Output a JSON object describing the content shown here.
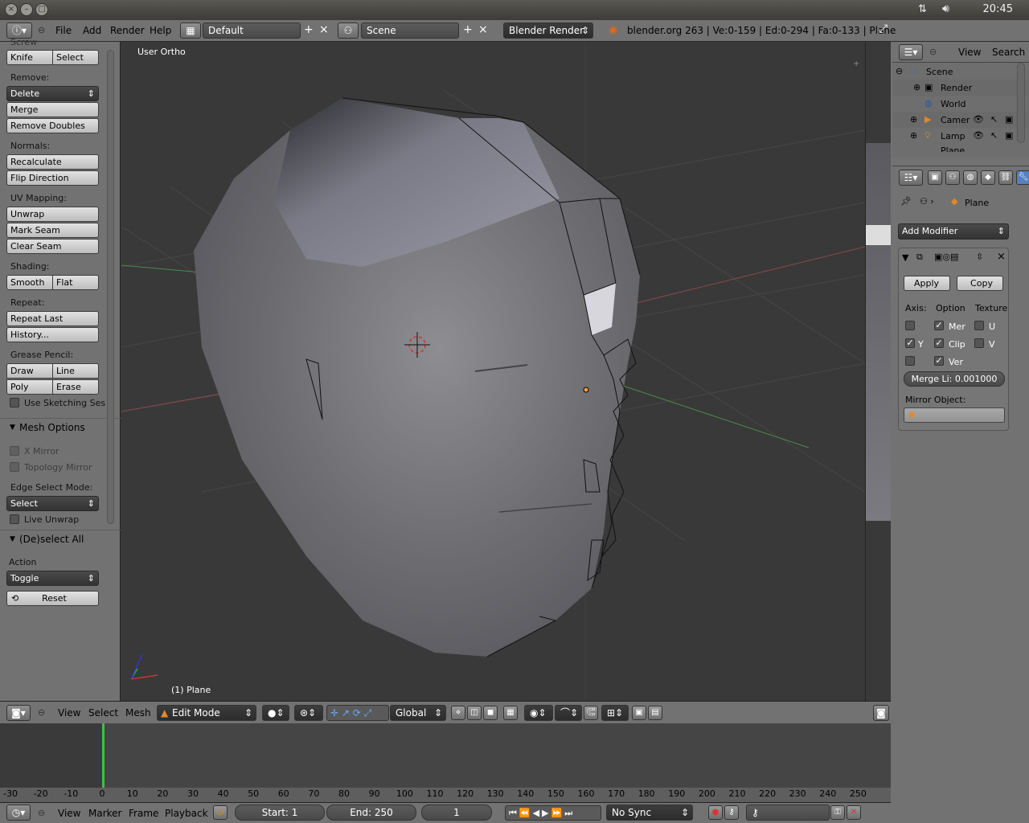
{
  "os": {
    "clock": "20:45"
  },
  "info": {
    "menus": [
      "File",
      "Add",
      "Render",
      "Help"
    ],
    "layout": "Default",
    "scene": "Scene",
    "engine": "Blender Render",
    "stats": "blender.org 263 | Ve:0-159 | Ed:0-294 | Fa:0-133 | Plane"
  },
  "tools": {
    "top_cut": "Screw",
    "knife": "Knife",
    "select": "Select",
    "remove_label": "Remove:",
    "delete": "Delete",
    "merge": "Merge",
    "remove_doubles": "Remove Doubles",
    "normals_label": "Normals:",
    "recalculate": "Recalculate",
    "flip_direction": "Flip Direction",
    "uv_label": "UV Mapping:",
    "unwrap": "Unwrap",
    "mark_seam": "Mark Seam",
    "clear_seam": "Clear Seam",
    "shading_label": "Shading:",
    "smooth": "Smooth",
    "flat": "Flat",
    "repeat_label": "Repeat:",
    "repeat_last": "Repeat Last",
    "history": "History...",
    "grease_label": "Grease Pencil:",
    "draw": "Draw",
    "line": "Line",
    "poly": "Poly",
    "erase": "Erase",
    "use_sketching": "Use Sketching Ses",
    "mesh_options": "Mesh Options",
    "x_mirror": "X Mirror",
    "topology_mirror": "Topology Mirror",
    "edge_select_label": "Edge Select Mode:",
    "edge_select_value": "Select",
    "live_unwrap": "Live Unwrap",
    "deselect_all": "(De)select All",
    "action_label": "Action",
    "action_value": "Toggle",
    "reset": "Reset"
  },
  "viewport": {
    "view_name": "User Ortho",
    "object_label": "(1) Plane"
  },
  "outliner": {
    "view": "View",
    "search": "Search",
    "items": [
      "Scene",
      "Render",
      "World",
      "Camer",
      "Lamp",
      "Plane"
    ]
  },
  "props": {
    "breadcrumb_object": "Plane",
    "add_modifier": "Add Modifier",
    "apply": "Apply",
    "copy": "Copy",
    "axis_label": "Axis:",
    "option_label": "Option",
    "texture_label": "Texture",
    "mer": "Mer",
    "clip": "Clip",
    "ver": "Ver",
    "y": "Y",
    "u": "U",
    "v": "V",
    "merge_limit": "Merge Li: 0.001000",
    "mirror_object_label": "Mirror Object:"
  },
  "view_header": {
    "menus": [
      "View",
      "Select",
      "Mesh"
    ],
    "mode": "Edit Mode",
    "orientation": "Global"
  },
  "timeline": {
    "ticks": [
      "-30",
      "-20",
      "-10",
      "0",
      "10",
      "20",
      "30",
      "40",
      "50",
      "60",
      "70",
      "80",
      "90",
      "100",
      "110",
      "120",
      "130",
      "140",
      "150",
      "160",
      "170",
      "180",
      "190",
      "200",
      "210",
      "220",
      "230",
      "240",
      "250"
    ],
    "menus": [
      "View",
      "Marker",
      "Frame",
      "Playback"
    ],
    "start": "Start: 1",
    "end": "End: 250",
    "current": "1",
    "sync": "No Sync"
  }
}
